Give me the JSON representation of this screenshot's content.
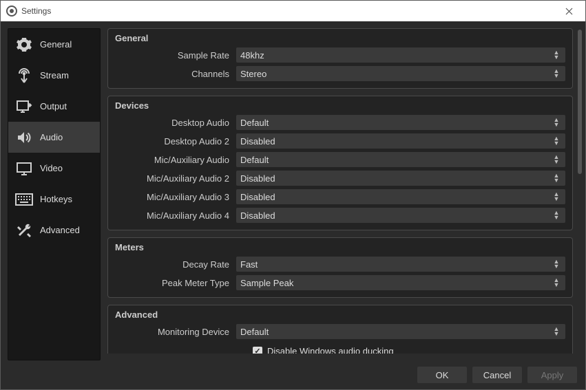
{
  "window": {
    "title": "Settings"
  },
  "sidebar": {
    "items": [
      {
        "label": "General"
      },
      {
        "label": "Stream"
      },
      {
        "label": "Output"
      },
      {
        "label": "Audio"
      },
      {
        "label": "Video"
      },
      {
        "label": "Hotkeys"
      },
      {
        "label": "Advanced"
      }
    ],
    "selected_index": 3
  },
  "groups": {
    "general": {
      "title": "General",
      "sample_rate": {
        "label": "Sample Rate",
        "value": "48khz"
      },
      "channels": {
        "label": "Channels",
        "value": "Stereo"
      }
    },
    "devices": {
      "title": "Devices",
      "desktop_audio": {
        "label": "Desktop Audio",
        "value": "Default"
      },
      "desktop_audio_2": {
        "label": "Desktop Audio 2",
        "value": "Disabled"
      },
      "mic_aux": {
        "label": "Mic/Auxiliary Audio",
        "value": "Default"
      },
      "mic_aux_2": {
        "label": "Mic/Auxiliary Audio 2",
        "value": "Disabled"
      },
      "mic_aux_3": {
        "label": "Mic/Auxiliary Audio 3",
        "value": "Disabled"
      },
      "mic_aux_4": {
        "label": "Mic/Auxiliary Audio 4",
        "value": "Disabled"
      }
    },
    "meters": {
      "title": "Meters",
      "decay_rate": {
        "label": "Decay Rate",
        "value": "Fast"
      },
      "peak_meter_type": {
        "label": "Peak Meter Type",
        "value": "Sample Peak"
      }
    },
    "advanced": {
      "title": "Advanced",
      "monitoring_device": {
        "label": "Monitoring Device",
        "value": "Default"
      },
      "disable_ducking": {
        "label": "Disable Windows audio ducking",
        "checked": true
      }
    }
  },
  "footer": {
    "ok": "OK",
    "cancel": "Cancel",
    "apply": "Apply"
  }
}
